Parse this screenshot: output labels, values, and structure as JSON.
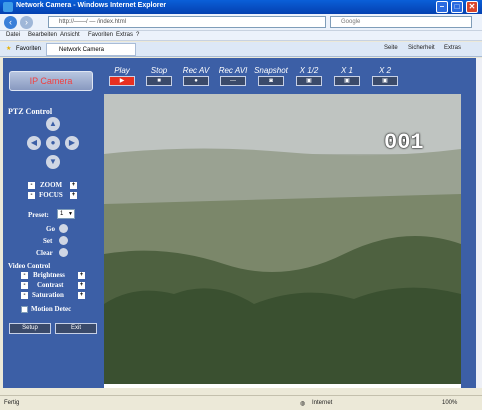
{
  "window": {
    "title": "Network Camera - Windows Internet Explorer"
  },
  "address": {
    "url": "http://——/ — /index.html",
    "search_placeholder": "Google"
  },
  "menu": [
    "Datei",
    "Bearbeiten",
    "Ansicht",
    "Favoriten",
    "Extras",
    "?"
  ],
  "tabs": [
    {
      "label": "Favoriten"
    },
    {
      "label": "Network Camera"
    }
  ],
  "tab_tools": [
    "Seite",
    "Sicherheit",
    "Extras"
  ],
  "toolbar": {
    "buttons": [
      {
        "label": "Play",
        "glyph": "▶"
      },
      {
        "label": "Stop",
        "glyph": "■"
      },
      {
        "label": "Rec AV",
        "glyph": "●"
      },
      {
        "label": "Rec AVI",
        "glyph": "—"
      },
      {
        "label": "Snapshot",
        "glyph": "◙"
      },
      {
        "label": "X 1/2",
        "glyph": "▣"
      },
      {
        "label": "X 1",
        "glyph": "▣"
      },
      {
        "label": "X 2",
        "glyph": "▣"
      }
    ]
  },
  "sidebar": {
    "logo_text": "IP Camera",
    "ptz_title": "PTZ Control",
    "zoom_label": "ZOOM",
    "focus_label": "FOCUS",
    "preset_label": "Preset:",
    "preset_value": "1",
    "go_label": "Go",
    "set_label": "Set",
    "clear_label": "Clear",
    "video_control_title": "Video Control",
    "brightness_label": "Brightness",
    "contrast_label": "Contrast",
    "saturation_label": "Saturation",
    "motion_label": "Motion Detec",
    "bottom_btn1": "Setup",
    "bottom_btn2": "Exit"
  },
  "video": {
    "overlay_text": "001"
  },
  "status": {
    "left": "Fertig",
    "zone": "Internet",
    "zoom": "100%"
  },
  "colors": {
    "panel": "#3c5fa6",
    "play_active": "#e83020"
  }
}
